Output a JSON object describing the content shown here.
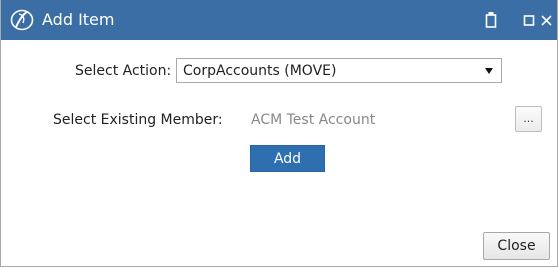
{
  "window": {
    "title": "Add Item",
    "titlebar_color": "#3a6ea5",
    "logo_icon": "stylized-d-logo",
    "controls": [
      "pin-icon",
      "maximize-icon",
      "close-icon"
    ],
    "close_glyph": "×"
  },
  "form": {
    "action_label": "Select Action:",
    "action_value": "CorpAccounts (MOVE)",
    "member_label": "Select Existing Member:",
    "member_value": "ACM Test Account",
    "browse_label": "...",
    "add_label": "Add",
    "add_color": "#2e6fb0"
  },
  "footer": {
    "close_label": "Close"
  }
}
